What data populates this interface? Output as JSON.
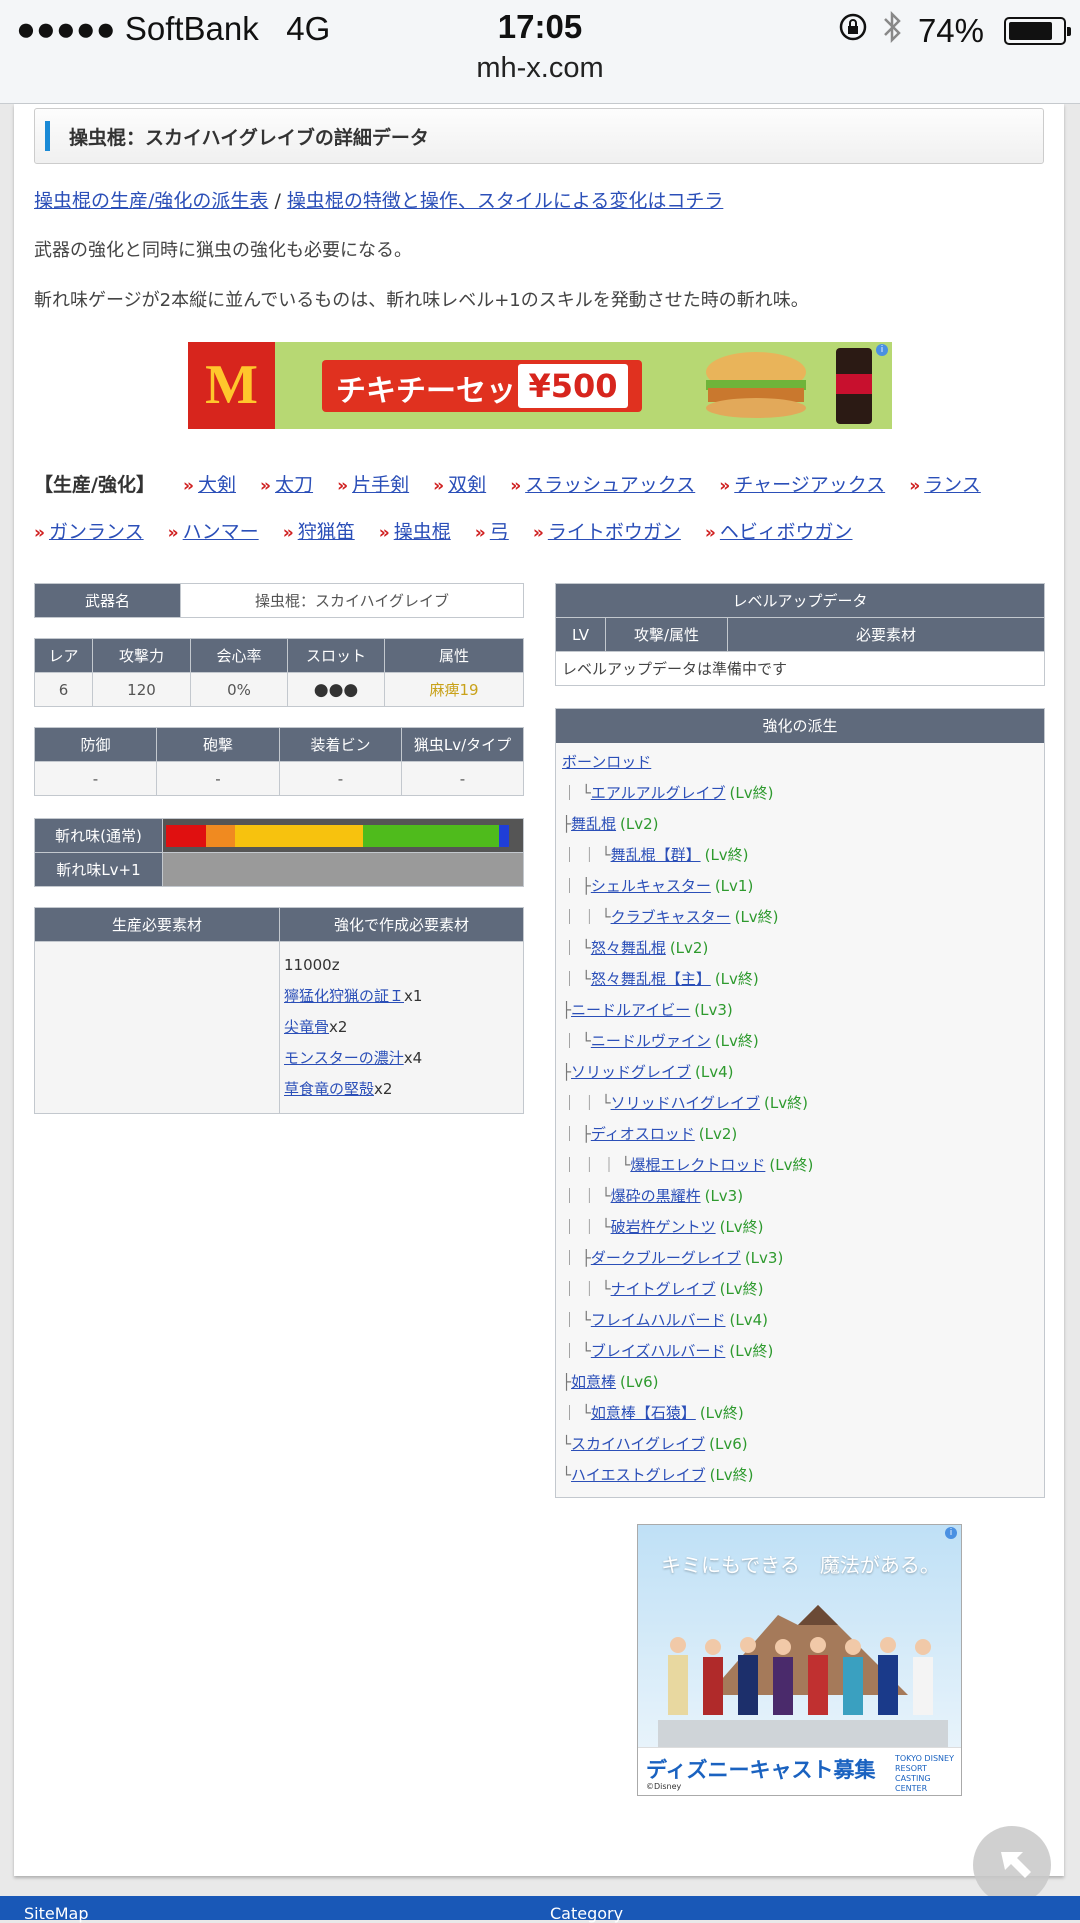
{
  "status": {
    "carrier": "SoftBank",
    "network": "4G",
    "time": "17:05",
    "battery": "74%",
    "url": "mh-x.com"
  },
  "header": {
    "title": "操虫棍：スカイハイグレイブの詳細データ"
  },
  "intro": {
    "link1": "操虫棍の生産/強化の派生表",
    "sep": " / ",
    "link2": "操虫棍の特徴と操作、スタイルによる変化はコチラ",
    "p1": "武器の強化と同時に猟虫の強化も必要になる。",
    "p2": "斬れ味ゲージが2本縦に並んでいるものは、斬れ味レベル+1のスキルを発動させた時の斬れ味。"
  },
  "ad1": {
    "text": "チキチーセット",
    "price": "¥500",
    "logo": "M"
  },
  "category_nav": {
    "label": "【生産/強化】",
    "items": [
      "大剣",
      "太刀",
      "片手剣",
      "双剣",
      "スラッシュアックス",
      "チャージアックス",
      "ランス",
      "ガンランス",
      "ハンマー",
      "狩猟笛",
      "操虫棍",
      "弓",
      "ライトボウガン",
      "ヘビィボウガン"
    ]
  },
  "weapon": {
    "name_label": "武器名",
    "name": "操虫棍：スカイハイグレイブ",
    "stat_headers": [
      "レア",
      "攻撃力",
      "会心率",
      "スロット",
      "属性"
    ],
    "stat_values": [
      "6",
      "120",
      "0%",
      "●●●",
      "麻痺19"
    ],
    "def_headers": [
      "防御",
      "砲撃",
      "装着ビン",
      "猟虫Lv/タイプ"
    ],
    "def_values": [
      "-",
      "-",
      "-",
      "-"
    ],
    "sharpness_label": "斬れ味(通常)",
    "sharpness_plus_label": "斬れ味Lv+1",
    "sharpness": [
      {
        "color": "#e01010",
        "share": 0.112
      },
      {
        "color": "#f08a20",
        "share": 0.082
      },
      {
        "color": "#f7c20e",
        "share": 0.362
      },
      {
        "color": "#4fbb1c",
        "share": 0.386
      },
      {
        "color": "#1f3ed8",
        "share": 0.026
      },
      {
        "color": "#555555",
        "share": 0.032
      }
    ]
  },
  "materials": {
    "headers": [
      "生産必要素材",
      "強化で作成必要素材"
    ],
    "zenny": "11000z",
    "items": [
      {
        "name": "獰猛化狩猟の証Ｉ",
        "qty": "x1"
      },
      {
        "name": "尖竜骨",
        "qty": "x2"
      },
      {
        "name": "モンスターの濃汁",
        "qty": "x4"
      },
      {
        "name": "草食竜の堅殻",
        "qty": "x2"
      }
    ]
  },
  "levelup": {
    "title": "レベルアップデータ",
    "headers": [
      "LV",
      "攻撃/属性",
      "必要素材"
    ],
    "note": "レベルアップデータは準備中です"
  },
  "tree": {
    "title": "強化の派生",
    "rows": [
      {
        "prefix": "",
        "name": "ボーンロッド",
        "lv": ""
      },
      {
        "prefix": "｜ └",
        "name": "エアルアルグレイブ",
        "lv": "(Lv終)"
      },
      {
        "prefix": "├",
        "name": "舞乱棍",
        "lv": "(Lv2)"
      },
      {
        "prefix": "｜ ｜ └",
        "name": "舞乱棍【群】",
        "lv": "(Lv終)"
      },
      {
        "prefix": "｜ ├",
        "name": "シェルキャスター",
        "lv": "(Lv1)"
      },
      {
        "prefix": "｜ ｜ └",
        "name": "クラブキャスター",
        "lv": "(Lv終)"
      },
      {
        "prefix": "｜ └",
        "name": "怒々舞乱棍",
        "lv": "(Lv2)"
      },
      {
        "prefix": "｜    └",
        "name": "怒々舞乱棍【主】",
        "lv": "(Lv終)"
      },
      {
        "prefix": "├",
        "name": "ニードルアイビー",
        "lv": "(Lv3)"
      },
      {
        "prefix": "｜ └",
        "name": "ニードルヴァイン",
        "lv": "(Lv終)"
      },
      {
        "prefix": "├",
        "name": "ソリッドグレイブ",
        "lv": "(Lv4)"
      },
      {
        "prefix": "｜ ｜ └",
        "name": "ソリッドハイグレイブ",
        "lv": "(Lv終)"
      },
      {
        "prefix": "｜ ├",
        "name": "ディオスロッド",
        "lv": "(Lv2)"
      },
      {
        "prefix": "｜ ｜ ｜ └",
        "name": "爆棍エレクトロッド",
        "lv": "(Lv終)"
      },
      {
        "prefix": "｜ ｜ └",
        "name": "爆砕の黒耀杵",
        "lv": "(Lv3)"
      },
      {
        "prefix": "｜ ｜    └",
        "name": "破岩杵ゲントツ",
        "lv": "(Lv終)"
      },
      {
        "prefix": "｜ ├",
        "name": "ダークブルーグレイブ",
        "lv": "(Lv3)"
      },
      {
        "prefix": "｜ ｜ └",
        "name": "ナイトグレイブ",
        "lv": "(Lv終)"
      },
      {
        "prefix": "｜ └",
        "name": "フレイムハルバード",
        "lv": "(Lv4)"
      },
      {
        "prefix": "｜    └",
        "name": "ブレイズハルバード",
        "lv": "(Lv終)"
      },
      {
        "prefix": "├",
        "name": "如意棒",
        "lv": "(Lv6)"
      },
      {
        "prefix": "｜ └",
        "name": "如意棒【石猿】",
        "lv": "(Lv終)"
      },
      {
        "prefix": "└",
        "name": "スカイハイグレイブ",
        "lv": "(Lv6)"
      },
      {
        "prefix": "   └",
        "name": "ハイエストグレイブ",
        "lv": "(Lv終)"
      }
    ]
  },
  "ad2": {
    "catch": "キミにもできる　魔法がある。",
    "bottom": "ディズニーキャスト募集",
    "copyright": "©Disney",
    "resort": "TOKYO DISNEY RESORT CASTING CENTER"
  },
  "footer": {
    "left": "SiteMap",
    "right": "Category"
  }
}
